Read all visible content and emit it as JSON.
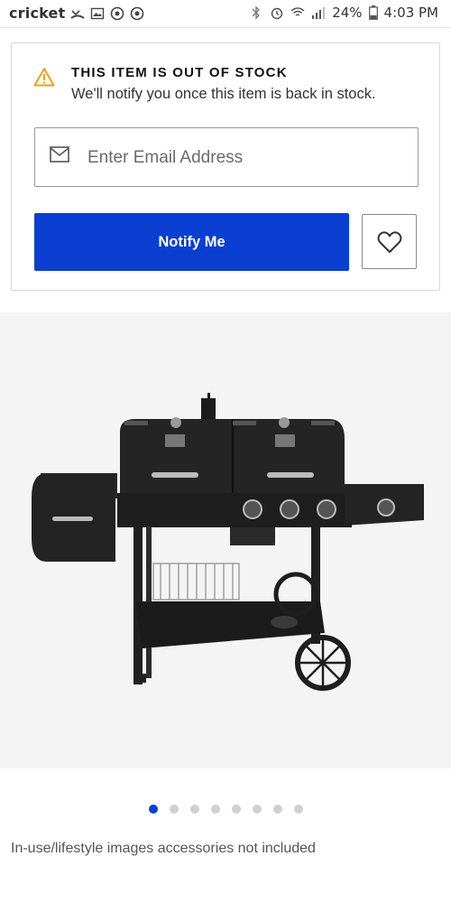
{
  "status_bar": {
    "carrier": "cricket",
    "battery": "24%",
    "time": "4:03 PM"
  },
  "out_of_stock": {
    "title": "THIS ITEM IS OUT OF STOCK",
    "subtitle": "We'll notify you once this item is back in stock.",
    "email_placeholder": "Enter Email Address",
    "notify_label": "Notify Me"
  },
  "colors": {
    "primary_button": "#0a3fd1",
    "warning": "#e8a317",
    "active_dot": "#0a3fd1"
  },
  "carousel": {
    "total_dots": 8,
    "active_index": 0
  },
  "disclaimer": "In-use/lifestyle images accessories not included",
  "icons": {
    "warning": "warning-triangle-icon",
    "mail": "mail-icon",
    "favorite": "heart-icon"
  }
}
